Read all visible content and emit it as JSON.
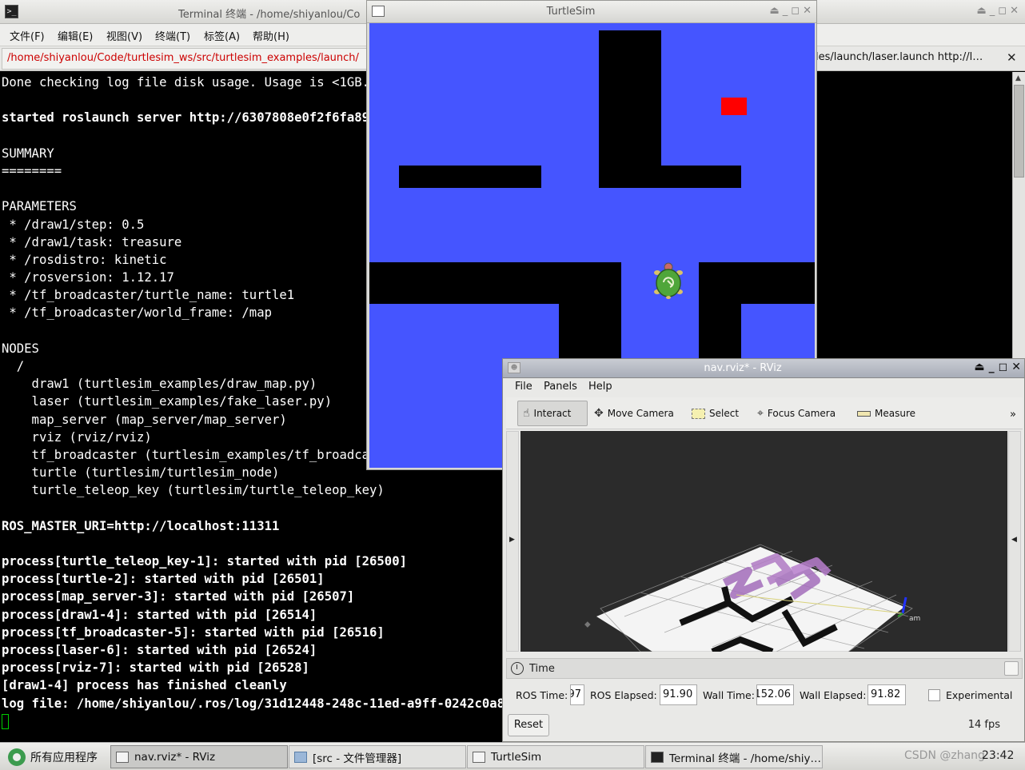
{
  "terminal": {
    "title": "Terminal 终端 - /home/shiyanlou/Co",
    "menu": [
      "文件(F)",
      "编辑(E)",
      "视图(V)",
      "终端(T)",
      "标签(A)",
      "帮助(H)"
    ],
    "tab_left": "/home/shiyanlou/Code/turtlesim_ws/src/turtlesim_examples/launch/",
    "tab_right": "les/launch/laser.launch http://l…",
    "lines": [
      {
        "t": "Done checking log file disk usage. Usage is <1GB.",
        "b": false
      },
      {
        "t": "",
        "b": false
      },
      {
        "t": "started roslaunch server http://6307808e0f2f6fa898a",
        "b": true
      },
      {
        "t": "",
        "b": false
      },
      {
        "t": "SUMMARY",
        "b": false
      },
      {
        "t": "========",
        "b": false
      },
      {
        "t": "",
        "b": false
      },
      {
        "t": "PARAMETERS",
        "b": false
      },
      {
        "t": " * /draw1/step: 0.5",
        "b": false
      },
      {
        "t": " * /draw1/task: treasure",
        "b": false
      },
      {
        "t": " * /rosdistro: kinetic",
        "b": false
      },
      {
        "t": " * /rosversion: 1.12.17",
        "b": false
      },
      {
        "t": " * /tf_broadcaster/turtle_name: turtle1",
        "b": false
      },
      {
        "t": " * /tf_broadcaster/world_frame: /map",
        "b": false
      },
      {
        "t": "",
        "b": false
      },
      {
        "t": "NODES",
        "b": false
      },
      {
        "t": "  /",
        "b": false
      },
      {
        "t": "    draw1 (turtlesim_examples/draw_map.py)",
        "b": false
      },
      {
        "t": "    laser (turtlesim_examples/fake_laser.py)",
        "b": false
      },
      {
        "t": "    map_server (map_server/map_server)",
        "b": false
      },
      {
        "t": "    rviz (rviz/rviz)",
        "b": false
      },
      {
        "t": "    tf_broadcaster (turtlesim_examples/tf_broadcast",
        "b": false
      },
      {
        "t": "    turtle (turtlesim/turtlesim_node)",
        "b": false
      },
      {
        "t": "    turtle_teleop_key (turtlesim/turtle_teleop_key)",
        "b": false
      },
      {
        "t": "",
        "b": false
      },
      {
        "t": "ROS_MASTER_URI=http://localhost:11311",
        "b": true
      },
      {
        "t": "",
        "b": false
      },
      {
        "t": "process[turtle_teleop_key-1]: started with pid [26500]",
        "b": true
      },
      {
        "t": "process[turtle-2]: started with pid [26501]",
        "b": true
      },
      {
        "t": "process[map_server-3]: started with pid [26507]",
        "b": true
      },
      {
        "t": "process[draw1-4]: started with pid [26514]",
        "b": true
      },
      {
        "t": "process[tf_broadcaster-5]: started with pid [26516]",
        "b": true
      },
      {
        "t": "process[laser-6]: started with pid [26524]",
        "b": true
      },
      {
        "t": "process[rviz-7]: started with pid [26528]",
        "b": true
      },
      {
        "t": "[draw1-4] process has finished cleanly",
        "b": true
      },
      {
        "t": "log file: /home/shiyanlou/.ros/log/31d12448-248c-11ed-a9ff-0242c0a82a0",
        "b": true
      }
    ]
  },
  "turtlesim": {
    "title": "TurtleSim",
    "background": "#4555ff"
  },
  "rviz": {
    "title": "nav.rviz* - RViz",
    "menu": [
      "File",
      "Panels",
      "Help"
    ],
    "tools": [
      {
        "label": "Interact",
        "icon": "hand-icon"
      },
      {
        "label": "Move Camera",
        "icon": "move-camera-icon"
      },
      {
        "label": "Select",
        "icon": "select-icon"
      },
      {
        "label": "Focus Camera",
        "icon": "focus-camera-icon"
      },
      {
        "label": "Measure",
        "icon": "ruler-icon"
      }
    ],
    "overflow": "»",
    "time_panel_title": "Time",
    "ros_time_label": "ROS Time:",
    "ros_time_value": "97",
    "ros_elapsed_label": "ROS Elapsed:",
    "ros_elapsed_value": "91.90",
    "wall_time_label": "Wall Time:",
    "wall_time_value": "152.06",
    "wall_elapsed_label": "Wall Elapsed:",
    "wall_elapsed_value": "91.82",
    "experimental_label": "Experimental",
    "reset_label": "Reset",
    "fps": "14 fps",
    "map_label": "am"
  },
  "taskbar": {
    "apps_label": "所有应用程序",
    "tasks": [
      "nav.rviz* - RViz",
      "[src - 文件管理器]",
      "TurtleSim",
      "Terminal 终端 - /home/shiy…"
    ],
    "watermark": "CSDN @zhang",
    "clock": "23:42"
  }
}
